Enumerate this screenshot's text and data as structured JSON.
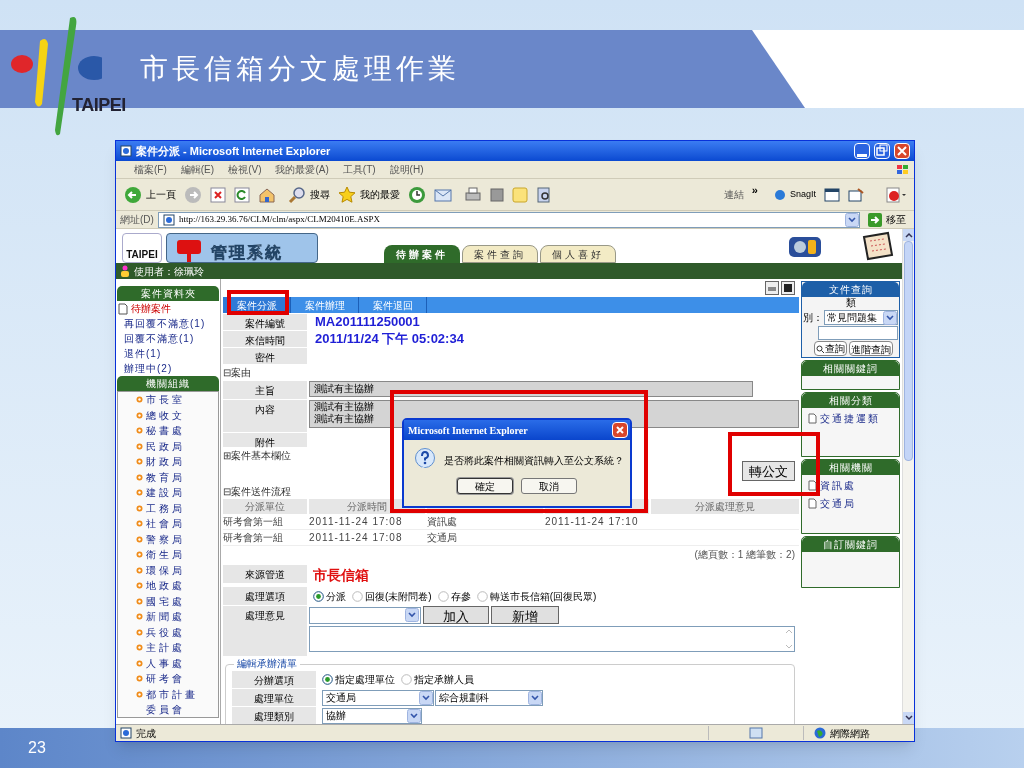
{
  "slide": {
    "title": "市長信箱分文處理作業",
    "logo_text": "TAIPEI",
    "page_number": "23"
  },
  "window": {
    "title": "案件分派 - Microsoft Internet Explorer"
  },
  "menu": [
    "檔案(F)",
    "編輯(E)",
    "檢視(V)",
    "我的最愛(A)",
    "工具(T)",
    "說明(H)"
  ],
  "toolbar": {
    "back": "上一頁",
    "search": "搜尋",
    "favorites": "我的最愛",
    "links": "連結",
    "links_more": "»",
    "snagit": "SnagIt"
  },
  "address_bar": {
    "label": "網址(D)",
    "url": "http://163.29.36.76/CLM/clm/aspx/CLM20410E.ASPX",
    "go": "移至"
  },
  "site_header": {
    "logo_text": "TAIPEI",
    "system_name": "管理系統"
  },
  "site_tabs": [
    {
      "label": "待辦案件",
      "selected": true
    },
    {
      "label": "案件查詢",
      "selected": false
    },
    {
      "label": "個人喜好",
      "selected": false
    }
  ],
  "user_bar": {
    "text": "使用者：徐珮玲"
  },
  "sidebar": [
    {
      "title": "案件資料夾",
      "items": [
        {
          "label": "待辦案件",
          "kind": "folder"
        },
        {
          "label": "再回覆不滿意(1)",
          "kind": "link"
        },
        {
          "label": "回覆不滿意(1)",
          "kind": "link"
        },
        {
          "label": "退件(1)",
          "kind": "link"
        },
        {
          "label": "辦理中(2)",
          "kind": "link"
        }
      ]
    },
    {
      "title": "機關組織",
      "items": [
        {
          "label": "市長室",
          "kind": "bullet"
        },
        {
          "label": "總收文",
          "kind": "bullet"
        },
        {
          "label": "秘書處",
          "kind": "bullet"
        },
        {
          "label": "民政局",
          "kind": "bullet"
        },
        {
          "label": "財政局",
          "kind": "bullet"
        },
        {
          "label": "教育局",
          "kind": "bullet"
        },
        {
          "label": "建設局",
          "kind": "bullet"
        },
        {
          "label": "工務局",
          "kind": "bullet"
        },
        {
          "label": "社會局",
          "kind": "bullet"
        },
        {
          "label": "警察局",
          "kind": "bullet"
        },
        {
          "label": "衛生局",
          "kind": "bullet"
        },
        {
          "label": "環保局",
          "kind": "bullet"
        },
        {
          "label": "地政處",
          "kind": "bullet"
        },
        {
          "label": "國宅處",
          "kind": "bullet"
        },
        {
          "label": "新聞處",
          "kind": "bullet"
        },
        {
          "label": "兵役處",
          "kind": "bullet"
        },
        {
          "label": "主計處",
          "kind": "bullet"
        },
        {
          "label": "人事處",
          "kind": "bullet"
        },
        {
          "label": "研考會",
          "kind": "bullet"
        },
        {
          "label": "都市計畫委員會",
          "kind": "bullet"
        }
      ]
    }
  ],
  "main": {
    "tabs": [
      {
        "label": "案件分派",
        "selected": true
      },
      {
        "label": "案件辦理",
        "selected": false
      },
      {
        "label": "案件退回",
        "selected": false
      }
    ],
    "fields": [
      {
        "label": "案件編號",
        "value": "MA201111250001"
      },
      {
        "label": "來信時間",
        "value": "2011/11/24 下午 05:02:34"
      },
      {
        "label": "密件"
      }
    ],
    "case_section": {
      "toggle": "⊟",
      "title": "案由"
    },
    "subject": {
      "label": "主旨",
      "value": "測試有主協辦"
    },
    "content": {
      "label": "內容",
      "lines": [
        "測試有主協辦",
        "測試有主協辦"
      ]
    },
    "attachment": {
      "label": "附件"
    },
    "basic_section": {
      "toggle": "⊞",
      "title": "案件基本欄位"
    },
    "transfer_button": "轉公文",
    "flow": {
      "toggle": "⊟",
      "title": "案件送件流程",
      "columns": {
        "unit": "分派單位",
        "time": "分派時間",
        "opinion": "分派處理意見"
      },
      "rows": [
        {
          "unit": "研考會第一組",
          "time": "2011-11-24 17:08",
          "column_3": "資訊處",
          "column_4": "2011-11-24 17:10"
        },
        {
          "unit": "研考會第一組",
          "time": "2011-11-24 17:08",
          "column_3": "交通局"
        }
      ],
      "summary": "(總頁數：1 總筆數：2)"
    },
    "source": {
      "label": "來源管道",
      "value": "市長信箱"
    },
    "options": {
      "label": "處理選項",
      "choices": [
        {
          "label": "分派",
          "selected": true
        },
        {
          "label": "回復(未附問卷)",
          "selected": false
        },
        {
          "label": "存參",
          "selected": false
        },
        {
          "label": "轉送市長信箱(回復民眾)",
          "selected": false
        }
      ]
    },
    "opinion": {
      "label": "處理意見",
      "add": "加入",
      "new": "新增"
    },
    "assign": {
      "legend": "編輯承辦清單",
      "mode": {
        "label": "分辦選項",
        "choices": [
          {
            "label": "指定處理單位",
            "selected": true
          },
          {
            "label": "指定承辦人員",
            "selected": false
          }
        ]
      },
      "unit": {
        "label": "處理單位",
        "values": [
          "交通局",
          "綜合規劃科"
        ]
      },
      "category": {
        "label": "處理類別",
        "value": "協辦"
      }
    }
  },
  "right_panel": {
    "search": {
      "title": "文件查詢",
      "label_top": "類",
      "label_bottom": "別：",
      "category": "常見問題集",
      "query": "查詢",
      "advanced": "進階查詢"
    },
    "keywords": {
      "title": "相關關鍵詞"
    },
    "categories": {
      "title": "相關分類",
      "items": [
        "交通捷運類"
      ]
    },
    "agencies": {
      "title": "相關機關",
      "items": [
        "資訊處",
        "交通局"
      ]
    },
    "custom": {
      "title": "自訂關鍵詞"
    }
  },
  "dialog": {
    "title": "Microsoft Internet Explorer",
    "message": "是否將此案件相關資訊轉入至公文系統？",
    "buttons": [
      "確定",
      "取消"
    ]
  },
  "status_bar": {
    "text": "完成",
    "zone": "網際網路"
  }
}
